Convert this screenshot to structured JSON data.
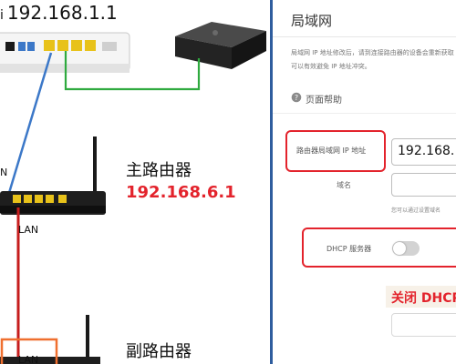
{
  "left": {
    "top_ip_prefix": "i",
    "top_ip": "192.168.1.1",
    "main_router_title": "主路由器",
    "main_router_ip": "192.168.6.1",
    "side_label": "N",
    "lan_label": "LAN",
    "secondary_router_title": "副路由器",
    "lan_port_label": "LAN"
  },
  "right": {
    "section_title": "局域网",
    "description_line1": "局域网 IP 地址修改后，请到连接路由器的设备会重新获取",
    "description_line2": "可以有效避免 IP 地址冲突。",
    "help_link": "页面帮助",
    "ip_field_label": "路由器局域网 IP 地址",
    "ip_field_value": "192.168.",
    "domain_label": "域名",
    "domain_value": "",
    "domain_hint": "您可以通过设置域名",
    "dhcp_label": "DHCP 服务器",
    "dhcp_enabled": false,
    "badge_text": "关闭 DHCP"
  },
  "colors": {
    "accent_red": "#e3232c",
    "divider_blue": "#2f5d9e",
    "cable_blue": "#3c78c8",
    "cable_green": "#2faa3f",
    "cable_red": "#c61d1d",
    "port_yellow": "#e8c21a"
  }
}
